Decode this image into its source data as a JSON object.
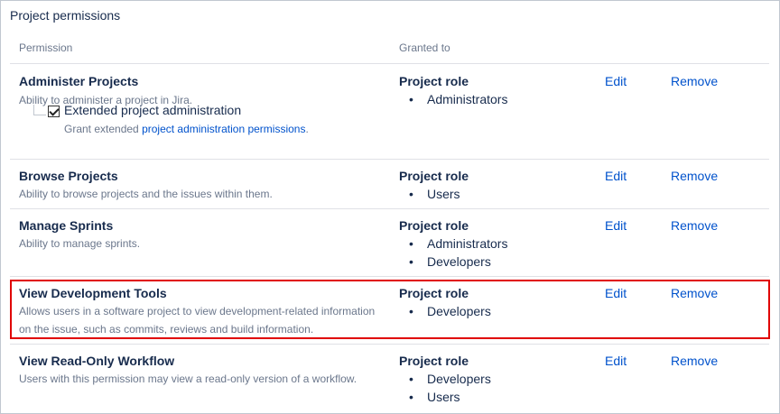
{
  "section": {
    "title": "Project permissions"
  },
  "columns": {
    "permission": "Permission",
    "granted_to": "Granted to"
  },
  "actions": {
    "edit": "Edit",
    "remove": "Remove"
  },
  "permissions": [
    {
      "name": "Administer Projects",
      "description": "Ability to administer a project in Jira.",
      "role": "Project role",
      "members": [
        "Administrators"
      ],
      "sub_permission": {
        "label": "Extended project administration",
        "checked": true,
        "desc_prefix": "Grant extended ",
        "desc_link": "project administration permissions",
        "desc_suffix": "."
      }
    },
    {
      "name": "Browse Projects",
      "description": "Ability to browse projects and the issues within them.",
      "role": "Project role",
      "members": [
        "Users"
      ]
    },
    {
      "name": "Manage Sprints",
      "description": "Ability to manage sprints.",
      "role": "Project role",
      "members": [
        "Administrators",
        "Developers"
      ]
    },
    {
      "name": "View Development Tools",
      "description": "Allows users in a software project to view development-related information on the issue, such as commits, reviews and build information.",
      "role": "Project role",
      "members": [
        "Developers"
      ]
    },
    {
      "name": "View Read-Only Workflow",
      "description": "Users with this permission may view a read-only version of a workflow.",
      "role": "Project role",
      "members": [
        "Developers",
        "Users"
      ]
    }
  ],
  "highlight_color": "#e00000",
  "link_color": "#0052cc"
}
